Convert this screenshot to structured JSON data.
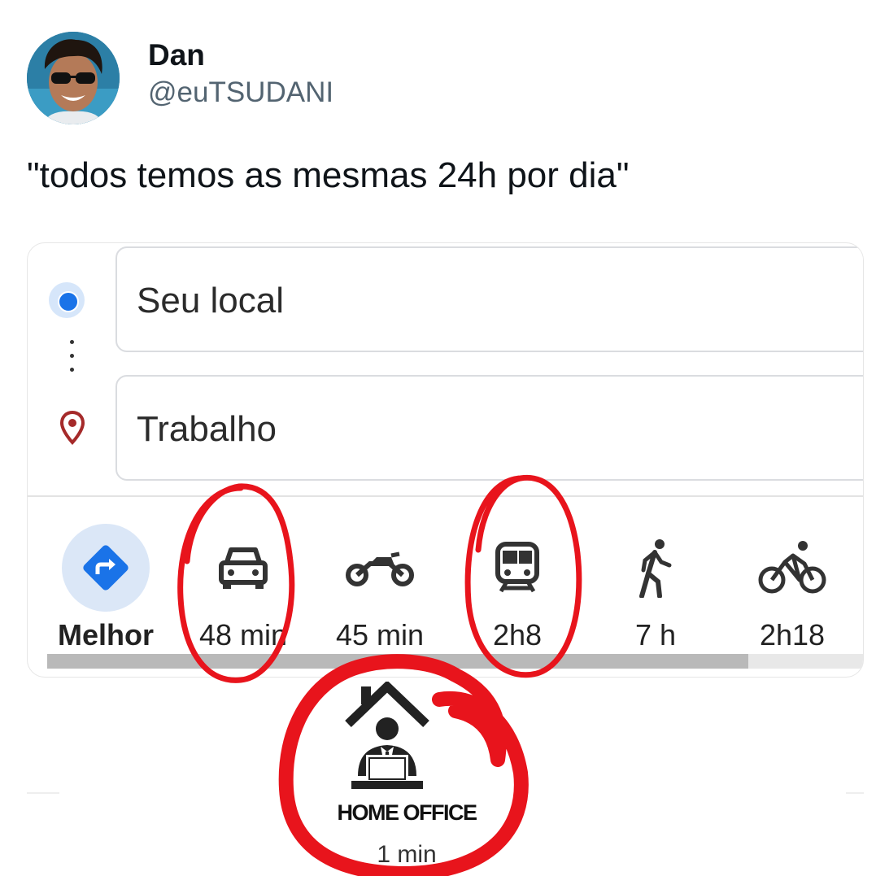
{
  "tweet": {
    "author_name": "Dan",
    "author_handle": "@euTSUDANI",
    "text": "\"todos temos as mesmas 24h por dia\""
  },
  "maps": {
    "origin": "Seu local",
    "destination": "Trabalho",
    "modes": [
      {
        "id": "best",
        "icon": "directions-icon",
        "label": "Melhor"
      },
      {
        "id": "car",
        "icon": "car-icon",
        "label": "48 min"
      },
      {
        "id": "motorcycle",
        "icon": "motorcycle-icon",
        "label": "45 min"
      },
      {
        "id": "transit",
        "icon": "train-icon",
        "label": "2h8"
      },
      {
        "id": "walk",
        "icon": "walk-icon",
        "label": "7 h"
      },
      {
        "id": "bike",
        "icon": "bike-icon",
        "label": "2h18"
      }
    ],
    "colors": {
      "accent": "#1a73e8",
      "pin": "#a52a2a"
    }
  },
  "home_office": {
    "icon": "home-office-icon",
    "title": "HOME OFFICE",
    "time": "1 min"
  },
  "annotations": {
    "color": "#e8141c"
  }
}
